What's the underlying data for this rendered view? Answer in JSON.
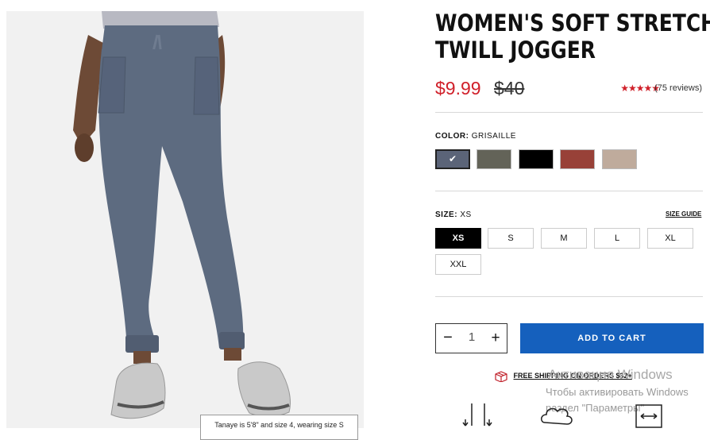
{
  "product": {
    "title_line1": "WOMEN'S SOFT STRETCH",
    "title_line2": "TWILL JOGGER",
    "sale_price": "$9.99",
    "original_price": "$40",
    "rating_stars": "★★★★★",
    "rating_value": 5,
    "reviews": "(75 reviews)",
    "photo_caption": "Tanaye is 5'8\" and size 4, wearing size S"
  },
  "color": {
    "label": "COLOR:",
    "selected": "GRISAILLE",
    "swatches": [
      {
        "name": "grisaille",
        "hex": "#5b6478",
        "selected": true
      },
      {
        "name": "olive",
        "hex": "#636358",
        "selected": false
      },
      {
        "name": "black",
        "hex": "#000000",
        "selected": false
      },
      {
        "name": "red",
        "hex": "#984138",
        "selected": false
      },
      {
        "name": "taupe",
        "hex": "#bfab9c",
        "selected": false
      }
    ]
  },
  "size": {
    "label": "SIZE:",
    "selected": "XS",
    "guide": "SIZE GUIDE",
    "options": [
      "XS",
      "S",
      "M",
      "L",
      "XL",
      "XXL"
    ]
  },
  "quantity": {
    "minus": "−",
    "value": "1",
    "plus": "+"
  },
  "cart": {
    "button": "ADD TO CART",
    "color": "#1560bd"
  },
  "shipping": {
    "text": "FREE SHIPPING ON ORDERS $32+"
  },
  "watermark": {
    "line1": "Активация Windows",
    "line2": "Чтобы активировать Windows",
    "line3": "раздел \"Параметры\""
  },
  "colors": {
    "accent_red": "#d0202a",
    "pant_blue": "#5d6b80"
  },
  "icons": [
    "check-icon",
    "box-icon",
    "fit-arrows-icon",
    "cloud-icon",
    "stretch-arrows-icon"
  ]
}
